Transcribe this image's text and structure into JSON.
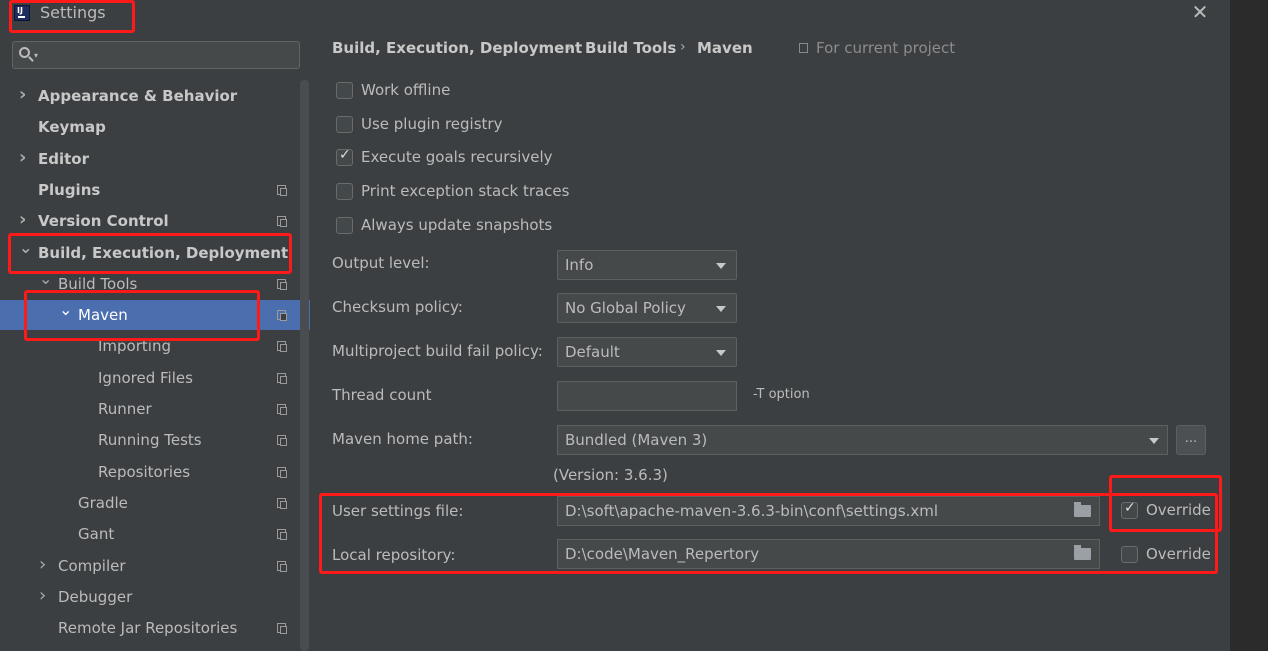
{
  "window": {
    "title": "Settings",
    "close_icon": "close-icon"
  },
  "sidebar": {
    "search_placeholder": "",
    "items": [
      {
        "label": "Appearance & Behavior",
        "expandable": true,
        "expanded": false,
        "bold": true,
        "level": 0,
        "copy_icon": false
      },
      {
        "label": "Keymap",
        "expandable": false,
        "bold": true,
        "level": 0,
        "copy_icon": false
      },
      {
        "label": "Editor",
        "expandable": true,
        "expanded": false,
        "bold": true,
        "level": 0,
        "copy_icon": false
      },
      {
        "label": "Plugins",
        "expandable": false,
        "bold": true,
        "level": 0,
        "copy_icon": true
      },
      {
        "label": "Version Control",
        "expandable": true,
        "expanded": false,
        "bold": true,
        "level": 0,
        "copy_icon": true
      },
      {
        "label": "Build, Execution, Deployment",
        "expandable": true,
        "expanded": true,
        "bold": true,
        "level": 0,
        "copy_icon": false
      },
      {
        "label": "Build Tools",
        "expandable": true,
        "expanded": true,
        "bold": false,
        "level": 1,
        "copy_icon": true
      },
      {
        "label": "Maven",
        "expandable": true,
        "expanded": true,
        "bold": false,
        "level": 2,
        "copy_icon": true,
        "selected": true
      },
      {
        "label": "Importing",
        "expandable": false,
        "bold": false,
        "level": 3,
        "copy_icon": true
      },
      {
        "label": "Ignored Files",
        "expandable": false,
        "bold": false,
        "level": 3,
        "copy_icon": true
      },
      {
        "label": "Runner",
        "expandable": false,
        "bold": false,
        "level": 3,
        "copy_icon": true
      },
      {
        "label": "Running Tests",
        "expandable": false,
        "bold": false,
        "level": 3,
        "copy_icon": true
      },
      {
        "label": "Repositories",
        "expandable": false,
        "bold": false,
        "level": 3,
        "copy_icon": true
      },
      {
        "label": "Gradle",
        "expandable": false,
        "bold": false,
        "level": 2,
        "copy_icon": true
      },
      {
        "label": "Gant",
        "expandable": false,
        "bold": false,
        "level": 2,
        "copy_icon": true
      },
      {
        "label": "Compiler",
        "expandable": true,
        "expanded": false,
        "bold": false,
        "level": 1,
        "copy_icon": true
      },
      {
        "label": "Debugger",
        "expandable": true,
        "expanded": false,
        "bold": false,
        "level": 1,
        "copy_icon": false
      },
      {
        "label": "Remote Jar Repositories",
        "expandable": false,
        "bold": false,
        "level": 1,
        "copy_icon": true
      }
    ]
  },
  "breadcrumb": {
    "items": [
      "Build, Execution, Deployment",
      "Build Tools",
      "Maven"
    ],
    "separator": "›",
    "scope": "For current project"
  },
  "checkboxes": [
    {
      "label": "Work offline",
      "checked": false
    },
    {
      "label": "Use plugin registry",
      "checked": false
    },
    {
      "label": "Execute goals recursively",
      "checked": true
    },
    {
      "label": "Print exception stack traces",
      "checked": false
    },
    {
      "label": "Always update snapshots",
      "checked": false
    }
  ],
  "fields": {
    "output_level": {
      "label": "Output level:",
      "value": "Info"
    },
    "checksum_policy": {
      "label": "Checksum policy:",
      "value": "No Global Policy"
    },
    "fail_policy": {
      "label": "Multiproject build fail policy:",
      "value": "Default"
    },
    "thread_count": {
      "label": "Thread count",
      "value": "",
      "hint": "-T option"
    },
    "maven_home": {
      "label": "Maven home path:",
      "value": "Bundled (Maven 3)",
      "browse_label": "...",
      "version": "(Version: 3.6.3)"
    },
    "user_settings": {
      "label": "User settings file:",
      "value": "D:\\soft\\apache-maven-3.6.3-bin\\conf\\settings.xml",
      "override_label": "Override",
      "override_checked": true
    },
    "local_repo": {
      "label": "Local repository:",
      "value": "D:\\code\\Maven_Repertory",
      "override_label": "Override",
      "override_checked": false
    }
  },
  "colors": {
    "background": "#3c3f41",
    "selection": "#4b6eaf",
    "highlight": "#ff1a1a",
    "text": "#bbbbbb"
  }
}
